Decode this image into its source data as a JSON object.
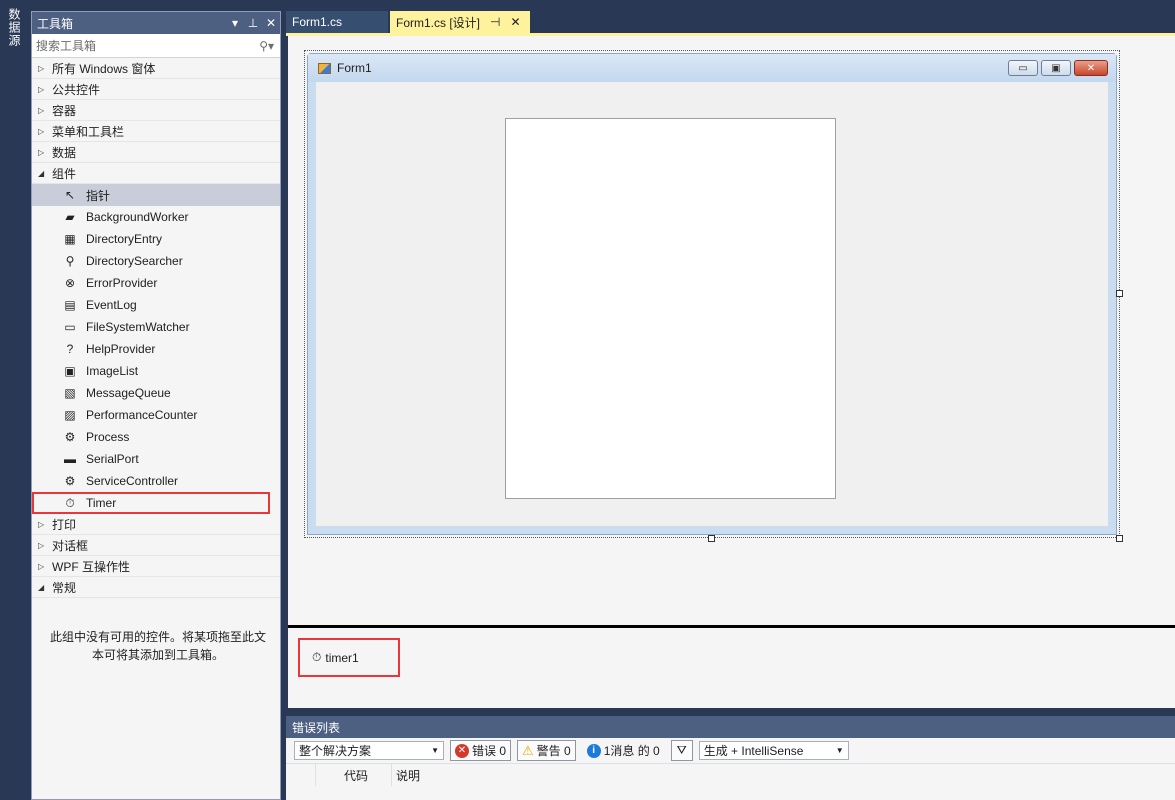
{
  "side_tab": {
    "label": "数据源"
  },
  "toolbox": {
    "title": "工具箱",
    "search_placeholder": "搜索工具箱",
    "categories_before": [
      "所有 Windows 窗体",
      "公共控件",
      "容器",
      "菜单和工具栏",
      "数据"
    ],
    "expanded_category": "组件",
    "components": [
      {
        "label": "指针",
        "icon": "pointer-icon",
        "glyph": "↖"
      },
      {
        "label": "BackgroundWorker",
        "icon": "background-worker-icon",
        "glyph": "▰"
      },
      {
        "label": "DirectoryEntry",
        "icon": "directory-entry-icon",
        "glyph": "▦"
      },
      {
        "label": "DirectorySearcher",
        "icon": "directory-searcher-icon",
        "glyph": "⚲"
      },
      {
        "label": "ErrorProvider",
        "icon": "error-provider-icon",
        "glyph": "⊗"
      },
      {
        "label": "EventLog",
        "icon": "event-log-icon",
        "glyph": "▤"
      },
      {
        "label": "FileSystemWatcher",
        "icon": "file-system-watcher-icon",
        "glyph": "▭"
      },
      {
        "label": "HelpProvider",
        "icon": "help-provider-icon",
        "glyph": "?"
      },
      {
        "label": "ImageList",
        "icon": "image-list-icon",
        "glyph": "▣"
      },
      {
        "label": "MessageQueue",
        "icon": "message-queue-icon",
        "glyph": "▧"
      },
      {
        "label": "PerformanceCounter",
        "icon": "performance-counter-icon",
        "glyph": "▨"
      },
      {
        "label": "Process",
        "icon": "process-icon",
        "glyph": "⚙"
      },
      {
        "label": "SerialPort",
        "icon": "serial-port-icon",
        "glyph": "▬"
      },
      {
        "label": "ServiceController",
        "icon": "service-controller-icon",
        "glyph": "⚙"
      },
      {
        "label": "Timer",
        "icon": "timer-icon",
        "glyph": "⏱"
      }
    ],
    "categories_after": [
      "打印",
      "对话框",
      "WPF 互操作性"
    ],
    "general_category": "常规",
    "empty_message": "此组中没有可用的控件。将某项拖至此文本可将其添加到工具箱。"
  },
  "tabs": {
    "code_tab": "Form1.cs",
    "design_tab": "Form1.cs [设计]"
  },
  "designer": {
    "form_title": "Form1",
    "tray_component": "timer1"
  },
  "error_list": {
    "title": "错误列表",
    "scope": "整个解决方案",
    "errors": "错误 0",
    "warnings": "警告 0",
    "messages": "1消息 的 0",
    "source": "生成 + IntelliSense",
    "col_code": "代码",
    "col_desc": "说明"
  },
  "colors": {
    "accent": "#293955",
    "active_tab": "#fff29d",
    "highlight_box": "#e8363a"
  }
}
